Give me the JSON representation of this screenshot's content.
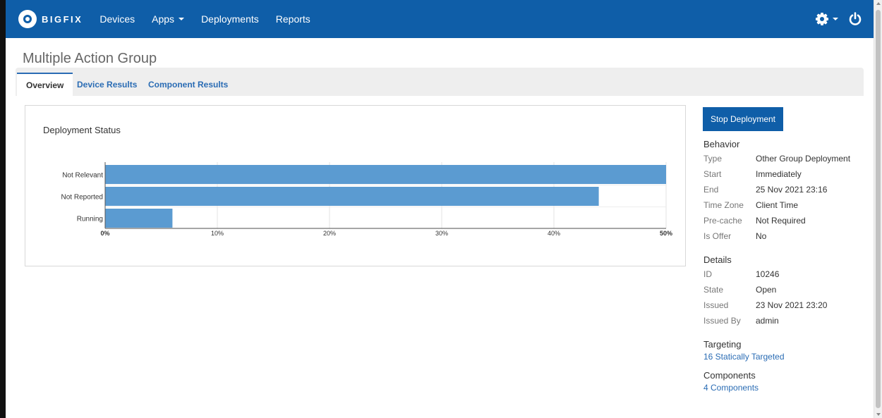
{
  "navbar": {
    "brand": "BIGFIX",
    "items": [
      {
        "label": "Devices"
      },
      {
        "label": "Apps"
      },
      {
        "label": "Deployments"
      },
      {
        "label": "Reports"
      }
    ]
  },
  "page": {
    "title": "Multiple Action Group"
  },
  "tabs": [
    {
      "label": "Overview",
      "active": true
    },
    {
      "label": "Device Results",
      "active": false
    },
    {
      "label": "Component Results",
      "active": false
    }
  ],
  "chart_data": {
    "type": "bar",
    "orientation": "horizontal",
    "title": "Deployment Status",
    "categories": [
      "Not Relevant",
      "Not Reported",
      "Running"
    ],
    "values": [
      50,
      44,
      6
    ],
    "xlim": [
      0,
      50
    ],
    "ticks": [
      "0%",
      "10%",
      "20%",
      "30%",
      "40%",
      "50%"
    ],
    "tick_values": [
      0,
      10,
      20,
      30,
      40,
      50
    ],
    "grid": true,
    "bar_color": "#5b9bd1"
  },
  "actions": {
    "stop_label": "Stop Deployment"
  },
  "behavior": {
    "heading": "Behavior",
    "rows": [
      {
        "label": "Type",
        "value": "Other Group Deployment"
      },
      {
        "label": "Start",
        "value": "Immediately"
      },
      {
        "label": "End",
        "value": "25 Nov 2021 23:16"
      },
      {
        "label": "Time Zone",
        "value": "Client Time"
      },
      {
        "label": "Pre-cache",
        "value": "Not Required"
      },
      {
        "label": "Is Offer",
        "value": "No"
      }
    ]
  },
  "details": {
    "heading": "Details",
    "rows": [
      {
        "label": "ID",
        "value": "10246"
      },
      {
        "label": "State",
        "value": "Open"
      },
      {
        "label": "Issued",
        "value": "23 Nov 2021 23:20"
      },
      {
        "label": "Issued By",
        "value": "admin"
      }
    ]
  },
  "targeting": {
    "heading": "Targeting",
    "link": "16 Statically Targeted"
  },
  "components": {
    "heading": "Components",
    "link": "4 Components"
  },
  "colors": {
    "navbar": "#0f5ea8",
    "link": "#2a6cb4",
    "bar": "#5b9bd1"
  }
}
